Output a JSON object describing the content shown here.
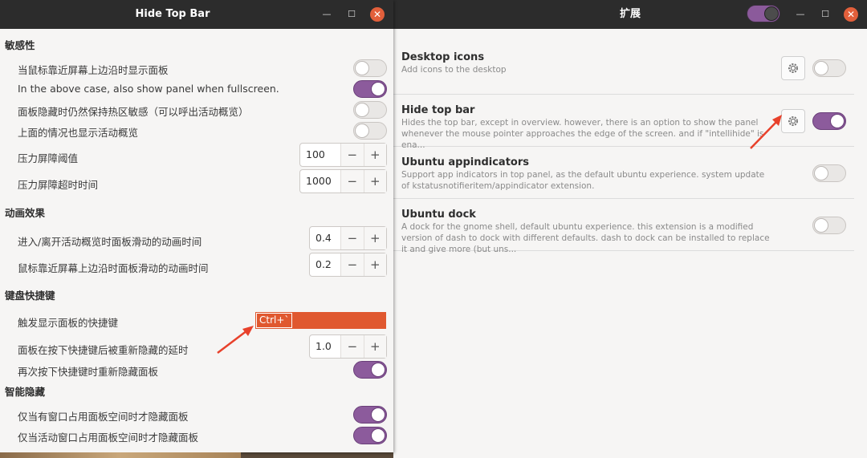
{
  "prefs_window": {
    "title": "Hide Top Bar",
    "sections": {
      "sensitivity": "敏感性",
      "animation": "动画效果",
      "shortcuts": "键盘快捷键",
      "intellihide": "智能隐藏"
    },
    "rows": {
      "show_on_edge": "当鼠标靠近屏幕上边沿时显示面板",
      "show_fullscreen": "In the above case, also show panel when fullscreen.",
      "hotcorner_sensitive": "面板隐藏时仍然保持热区敏感（可以呼出活动概览）",
      "also_overview": "上面的情况也显示活动概览",
      "pressure_threshold": "压力屏障阈值",
      "pressure_timeout": "压力屏障超时时间",
      "anim_overview": "进入/离开活动概览时面板滑动的动画时间",
      "anim_edge": "鼠标靠近屏幕上边沿时面板滑动的动画时间",
      "shortcut_label": "触发显示面板的快捷键",
      "rehide_delay": "面板在按下快捷键后被重新隐藏的延时",
      "rehide_again": "再次按下快捷键时重新隐藏面板",
      "only_window": "仅当有窗口占用面板空间时才隐藏面板",
      "only_active": "仅当活动窗口占用面板空间时才隐藏面板"
    },
    "values": {
      "pressure_threshold": "100",
      "pressure_timeout": "1000",
      "anim_overview": "0.4",
      "anim_edge": "0.2",
      "shortcut": "Ctrl+`",
      "rehide_delay": "1.0"
    },
    "toggle_states": {
      "show_on_edge": false,
      "show_fullscreen": true,
      "hotcorner_sensitive": false,
      "also_overview": false,
      "rehide_again": true,
      "only_window": true,
      "only_active": true
    },
    "spin_minus": "−",
    "spin_plus": "+"
  },
  "extensions_window": {
    "title": "扩展",
    "master_enabled": true,
    "items": [
      {
        "name": "Desktop icons",
        "description": "Add icons to the desktop",
        "has_settings": true,
        "enabled": false
      },
      {
        "name": "Hide top bar",
        "description": "Hides the top bar, except in overview. however, there is an option to show the panel whenever the mouse pointer approaches the edge of the screen. and if \"intellihide\" is ena...",
        "has_settings": true,
        "enabled": true
      },
      {
        "name": "Ubuntu appindicators",
        "description": "Support app indicators in top panel, as the default ubuntu experience. system update of kstatusnotifieritem/appindicator extension.",
        "has_settings": false,
        "enabled": false
      },
      {
        "name": "Ubuntu dock",
        "description": "A dock for the gnome shell, default ubuntu experience. this extension is a modified version of dash to dock with different defaults. dash to dock can be installed to replace it and give more (but uns...",
        "has_settings": false,
        "enabled": false
      }
    ]
  },
  "window_buttons": {
    "minimize": "—",
    "maximize": "☐",
    "close": "✕"
  },
  "icons": {
    "settings": "gear-icon",
    "annotation": "red-arrow-icon"
  },
  "colors": {
    "accent": "#8c5b9c",
    "shortcut_bg": "#e0582f",
    "close": "#e25f3b",
    "arrow": "#e8412b"
  }
}
